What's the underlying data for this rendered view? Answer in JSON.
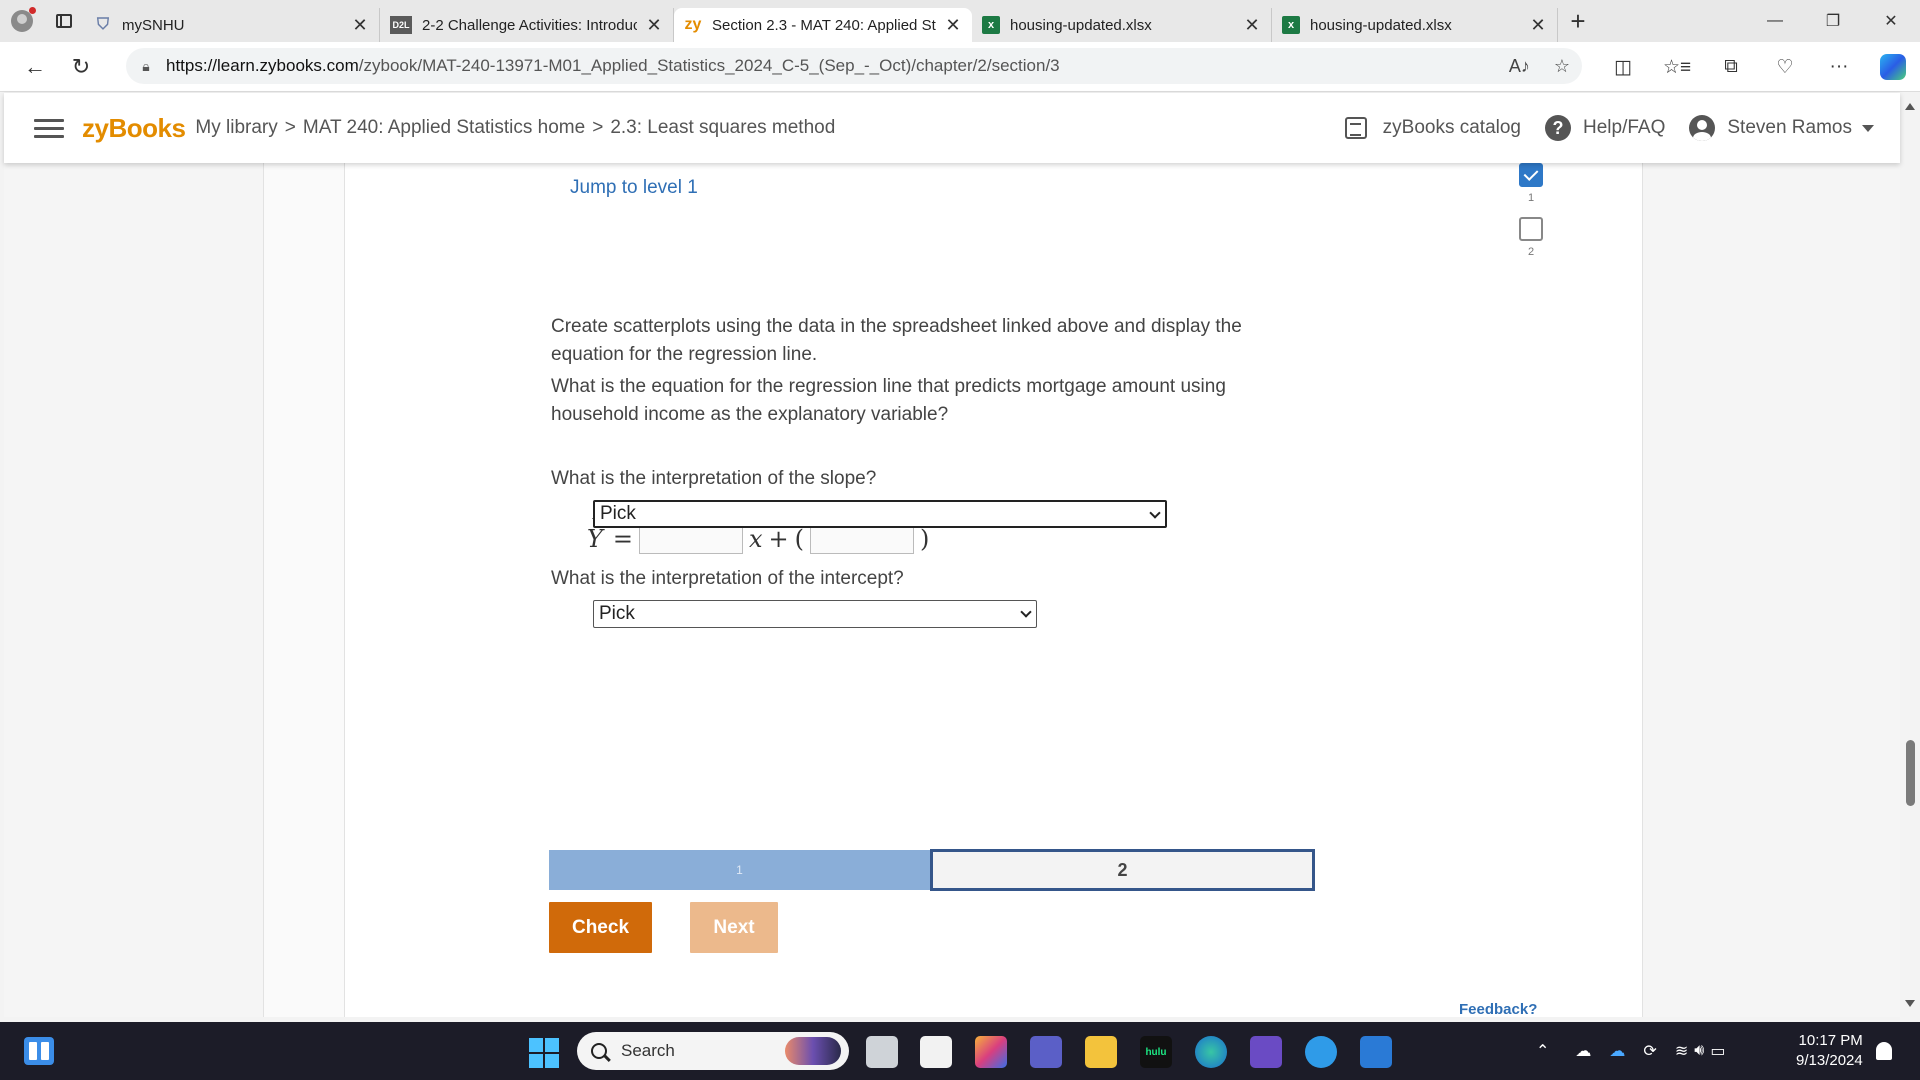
{
  "browser": {
    "tabs": [
      {
        "title": "mySNHU",
        "icon": "shield-icon",
        "active": false
      },
      {
        "title": "2-2 Challenge Activities: Introducti",
        "icon": "d2l-icon",
        "favicon_text": "D2L",
        "active": false
      },
      {
        "title": "Section 2.3 - MAT 240: Applied St",
        "icon": "zybooks-icon",
        "favicon_text": "zy",
        "active": true
      },
      {
        "title": "housing-updated.xlsx",
        "icon": "excel-icon",
        "favicon_text": "x",
        "active": false
      },
      {
        "title": "housing-updated.xlsx",
        "icon": "excel-icon",
        "favicon_text": "x",
        "active": false
      }
    ],
    "url_host": "https://learn.zybooks.com",
    "url_path": "/zybook/MAT-240-13971-M01_Applied_Statistics_2024_C-5_(Sep_-_Oct)/chapter/2/section/3"
  },
  "zybooks": {
    "logo": "zyBooks",
    "breadcrumb": [
      "My library",
      ">",
      "MAT 240: Applied Statistics home",
      ">",
      "2.3: Least squares method"
    ],
    "catalog_label": "zyBooks catalog",
    "help_label": "Help/FAQ",
    "user_name": "Steven Ramos"
  },
  "activity": {
    "jump_link": "Jump to level 1",
    "levels": [
      {
        "num": "1",
        "completed": true
      },
      {
        "num": "2",
        "completed": false
      }
    ],
    "intro_line1": "Create scatterplots using the data in the spreadsheet linked above and display the",
    "intro_line2": "equation for the regression line.",
    "question_line1": "What is the equation for the regression line that predicts mortgage amount using",
    "question_line2": "household income as the explanatory variable?",
    "equation": {
      "lhs": "Y",
      "equals": "=",
      "x_term": "x",
      "plus": "+",
      "open": "(",
      "close": ")",
      "slope_value": "",
      "intercept_value": ""
    },
    "slope_question": "What is the interpretation of the slope?",
    "slope_select": "Pick",
    "intercept_question": "What is the interpretation of the intercept?",
    "intercept_select": "Pick",
    "progress": [
      {
        "label": "1"
      },
      {
        "label": "2"
      }
    ],
    "check_label": "Check",
    "next_label": "Next",
    "feedback_label": "Feedback?"
  },
  "taskbar": {
    "search_label": "Search",
    "time": "10:17 PM",
    "date": "9/13/2024"
  },
  "colors": {
    "zybooks_orange": "#e38c00",
    "check_button": "#d06a0a",
    "next_button_disabled": "#ecb98c",
    "link_blue": "#2f6fb5",
    "progress_done": "#8aaed8",
    "progress_current_border": "#35568a"
  }
}
